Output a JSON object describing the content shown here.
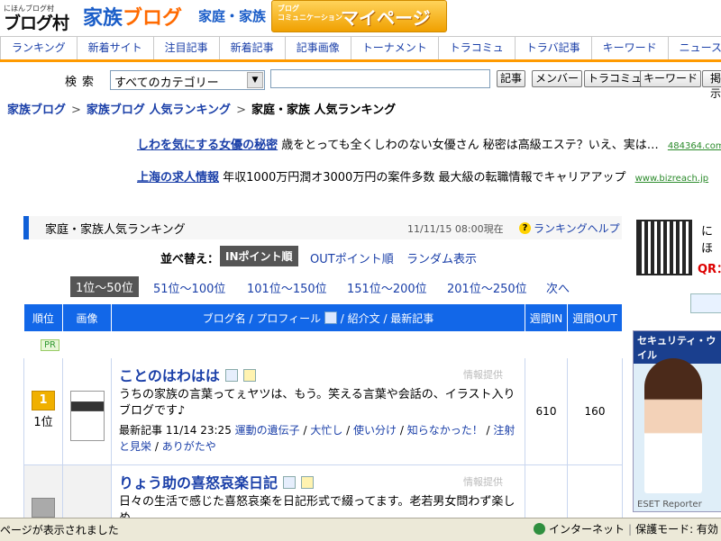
{
  "header": {
    "mura_small": "にほんブログ村",
    "mura_big": "ブログ村",
    "kazoku_a": "家族",
    "kazoku_b": "ブログ",
    "katei": "家庭・家族",
    "mypage_small_1": "ブログ",
    "mypage_small_2": "コミュニケーション",
    "mypage_big": "マイページ"
  },
  "nav": [
    "ランキング",
    "新着サイト",
    "注目記事",
    "新着記事",
    "記事画像",
    "トーナメント",
    "トラコミュ",
    "トラバ記事",
    "キーワード",
    "ニュース"
  ],
  "search": {
    "label": "検索",
    "category": "すべてのカテゴリー",
    "input_value": "",
    "buttons": [
      "記事",
      "メンバー",
      "トラコミュ",
      "キーワード",
      "掲示"
    ]
  },
  "breadcrumb": [
    "家族ブログ",
    "家族ブログ 人気ランキング",
    "家庭・家族 人気ランキング"
  ],
  "ads": [
    {
      "title": "しわを気にする女優の秘密",
      "text": "歳をとっても全くしわのない女優さん 秘密は高級エステ？いえ、実は…",
      "url": "484364.com"
    },
    {
      "title": "上海の求人情報",
      "text": "年収1000万円潤オ3000万円の案件多数 最大級の転職情報でキャリアアップ",
      "url": "www.bizreach.jp"
    }
  ],
  "ranking": {
    "title": "家庭・家族人気ランキング",
    "time": "11/11/15 08:00現在",
    "help": "ランキングヘルプ",
    "sort_label": "並べ替え：",
    "sort_in": "INポイント順",
    "sort_out": "OUTポイント順",
    "sort_random": "ランダム表示",
    "pages": [
      "1位〜50位",
      "51位〜100位",
      "101位〜150位",
      "151位〜200位",
      "201位〜250位",
      "次へ"
    ],
    "columns": {
      "rank": "順位",
      "image": "画像",
      "blog": "ブログ名 / プロフィール",
      "blog2": "/ 紹介文 / 最新記事",
      "in": "週間IN",
      "out": "週間OUT"
    },
    "pr": "PR",
    "info_label": "情報提供",
    "rows": [
      {
        "rank_num": "1",
        "rank": "1位",
        "title": "ことのはわはは",
        "desc": "うちの家族の言葉ってぇヤツは、もう。笑える言葉や会話の、イラスト入りブログです♪",
        "latest_label": "最新記事",
        "latest_time": "11/14 23:25",
        "latest_links": [
          "運動の遺伝子",
          "大忙し",
          "使い分け",
          "知らなかった！",
          "注射と見栄",
          "ありがたや"
        ],
        "in": "610",
        "out": "160"
      },
      {
        "rank": "",
        "title": "りょう助の喜怒哀楽日記",
        "desc": "日々の生活で感じた喜怒哀楽を日記形式で綴ってます。老若男女問わず楽しめ",
        "in": "",
        "out": ""
      }
    ]
  },
  "right": {
    "qr_text": "にほ",
    "qr_label": "QR：",
    "sec_ad_header": "セキュリティ・ウイル",
    "sec_ad_footer": "ESET Reporter"
  },
  "statusbar": {
    "text": "ページが表示されました",
    "zone": "インターネット",
    "protect": "保護モード: 有効"
  }
}
